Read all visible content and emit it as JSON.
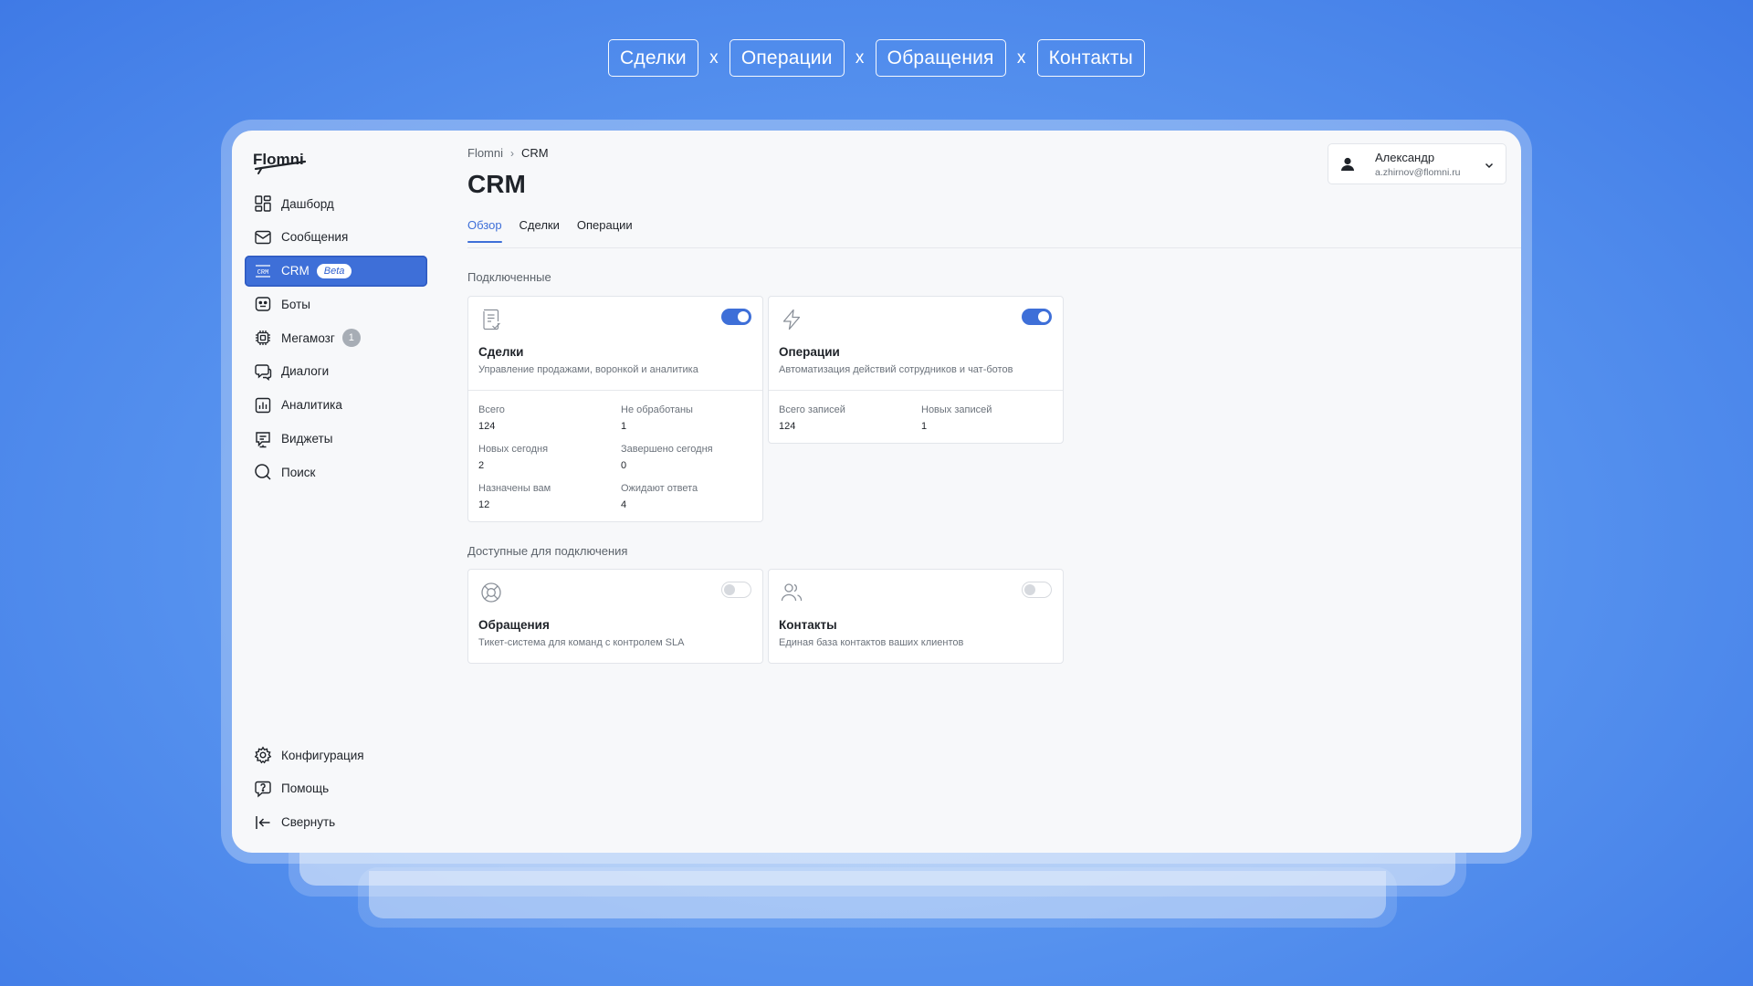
{
  "top_pills": [
    "Сделки",
    "Операции",
    "Обращения",
    "Контакты"
  ],
  "pill_separator": "x",
  "logo": {
    "text": "Flomni"
  },
  "colors": {
    "accent": "#3e6fd8",
    "background": "#5a96f0"
  },
  "sidebar": {
    "items": [
      {
        "label": "Дашборд",
        "icon": "dashboard-icon"
      },
      {
        "label": "Сообщения",
        "icon": "messages-icon"
      },
      {
        "label": "CRM",
        "icon": "crm-icon",
        "badge": "Beta",
        "active": true
      },
      {
        "label": "Боты",
        "icon": "bot-icon"
      },
      {
        "label": "Мегамозг",
        "icon": "chip-icon",
        "count": "1"
      },
      {
        "label": "Диалоги",
        "icon": "dialogs-icon"
      },
      {
        "label": "Аналитика",
        "icon": "analytics-icon"
      },
      {
        "label": "Виджеты",
        "icon": "widgets-icon"
      },
      {
        "label": "Поиск",
        "icon": "search-icon"
      }
    ],
    "bottom_items": [
      {
        "label": "Конфигурация",
        "icon": "gear-icon"
      },
      {
        "label": "Помощь",
        "icon": "help-icon"
      },
      {
        "label": "Свернуть",
        "icon": "collapse-icon"
      }
    ]
  },
  "breadcrumb": {
    "root": "Flomni",
    "current": "CRM"
  },
  "page_title": "CRM",
  "tabs": [
    {
      "label": "Обзор",
      "active": true
    },
    {
      "label": "Сделки"
    },
    {
      "label": "Операции"
    }
  ],
  "user": {
    "name": "Александр",
    "email": "a.zhirnov@flomni.ru"
  },
  "connected": {
    "label": "Подключенные",
    "cards": [
      {
        "title": "Сделки",
        "description": "Управление продажами, воронкой и аналитика",
        "enabled": true,
        "stats": [
          {
            "label": "Всего",
            "value": "124"
          },
          {
            "label": "Не обработаны",
            "value": "1"
          },
          {
            "label": "Новых сегодня",
            "value": "2"
          },
          {
            "label": "Завершено сегодня",
            "value": "0"
          },
          {
            "label": "Назначены вам",
            "value": "12"
          },
          {
            "label": "Ожидают ответа",
            "value": "4"
          }
        ]
      },
      {
        "title": "Операции",
        "description": "Автоматизация действий сотрудников и чат-ботов",
        "enabled": true,
        "stats": [
          {
            "label": "Всего записей",
            "value": "124"
          },
          {
            "label": "Новых записей",
            "value": "1"
          }
        ]
      }
    ]
  },
  "available": {
    "label": "Доступные для подключения",
    "cards": [
      {
        "title": "Обращения",
        "description": "Тикет-система для команд с контролем SLA",
        "enabled": false
      },
      {
        "title": "Контакты",
        "description": "Единая база контактов ваших клиентов",
        "enabled": false
      }
    ]
  }
}
